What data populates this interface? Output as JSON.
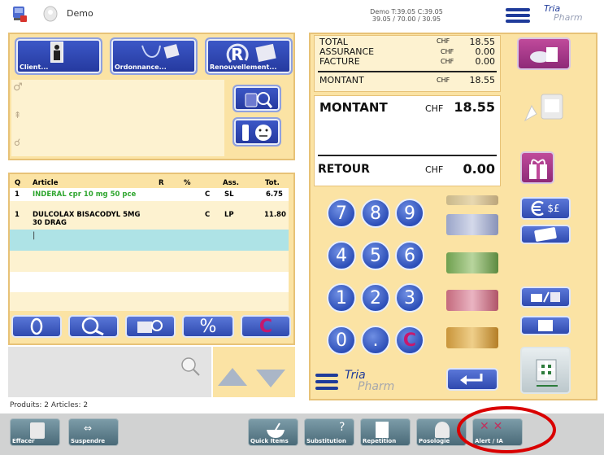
{
  "topbar": {
    "user": "Demo",
    "status_line1": "Demo  T:39.05 C:39.05",
    "status_line2": "39.05 / 70.00 / 30.95",
    "brand_top": "Tria",
    "brand_bottom": "Pharm"
  },
  "patient": {
    "client_label": "Client...",
    "ordonnance_label": "Ordonnance...",
    "renouvellement_label": "Renouvellement..."
  },
  "totals": {
    "rows": [
      {
        "label": "TOTAL",
        "currency": "CHF",
        "value": "18.55"
      },
      {
        "label": "ASSURANCE",
        "currency": "CHF",
        "value": "0.00"
      },
      {
        "label": "FACTURE",
        "currency": "CHF",
        "value": "0.00"
      },
      {
        "label": "MONTANT",
        "currency": "CHF",
        "value": "18.55"
      }
    ],
    "montant_label": "MONTANT",
    "montant_currency": "CHF",
    "montant_value": "18.55",
    "retour_label": "RETOUR",
    "retour_currency": "CHF",
    "retour_value": "0.00"
  },
  "table": {
    "headers": {
      "q": "Q",
      "article": "Article",
      "r": "R",
      "pct": "%",
      "ass": "Ass.",
      "tot": "Tot."
    },
    "rows": [
      {
        "q": "1",
        "article": "INDERAL cpr 10 mg 50 pce",
        "r": "",
        "pct": "C",
        "ass": "SL",
        "tot": "6.75",
        "color": "#2fa62f"
      },
      {
        "q": "1",
        "article": "DULCOLAX BISACODYL 5MG",
        "article2": "30 DRAG",
        "r": "",
        "pct": "C",
        "ass": "LP",
        "tot": "11.80",
        "color": "#111111"
      }
    ],
    "cursor": "|"
  },
  "keypad": {
    "keys": [
      "7",
      "8",
      "9",
      "4",
      "5",
      "6",
      "1",
      "2",
      "3",
      "0",
      ".",
      "C"
    ]
  },
  "tools": {
    "percent": "%",
    "clear": "C"
  },
  "status": {
    "text": "Produits: 2   Articles: 2"
  },
  "footer": {
    "buttons": [
      "Effacer",
      "Suspendre",
      "Quick Items",
      "Substitution",
      "Repetition",
      "Posologie",
      "Alert / IA"
    ]
  },
  "currency_button": "$£",
  "colors": {
    "panel": "#fbe3a4",
    "button_blue": "#2d48b6",
    "highlight_row": "#aee3e6",
    "circle": "#d90000"
  }
}
